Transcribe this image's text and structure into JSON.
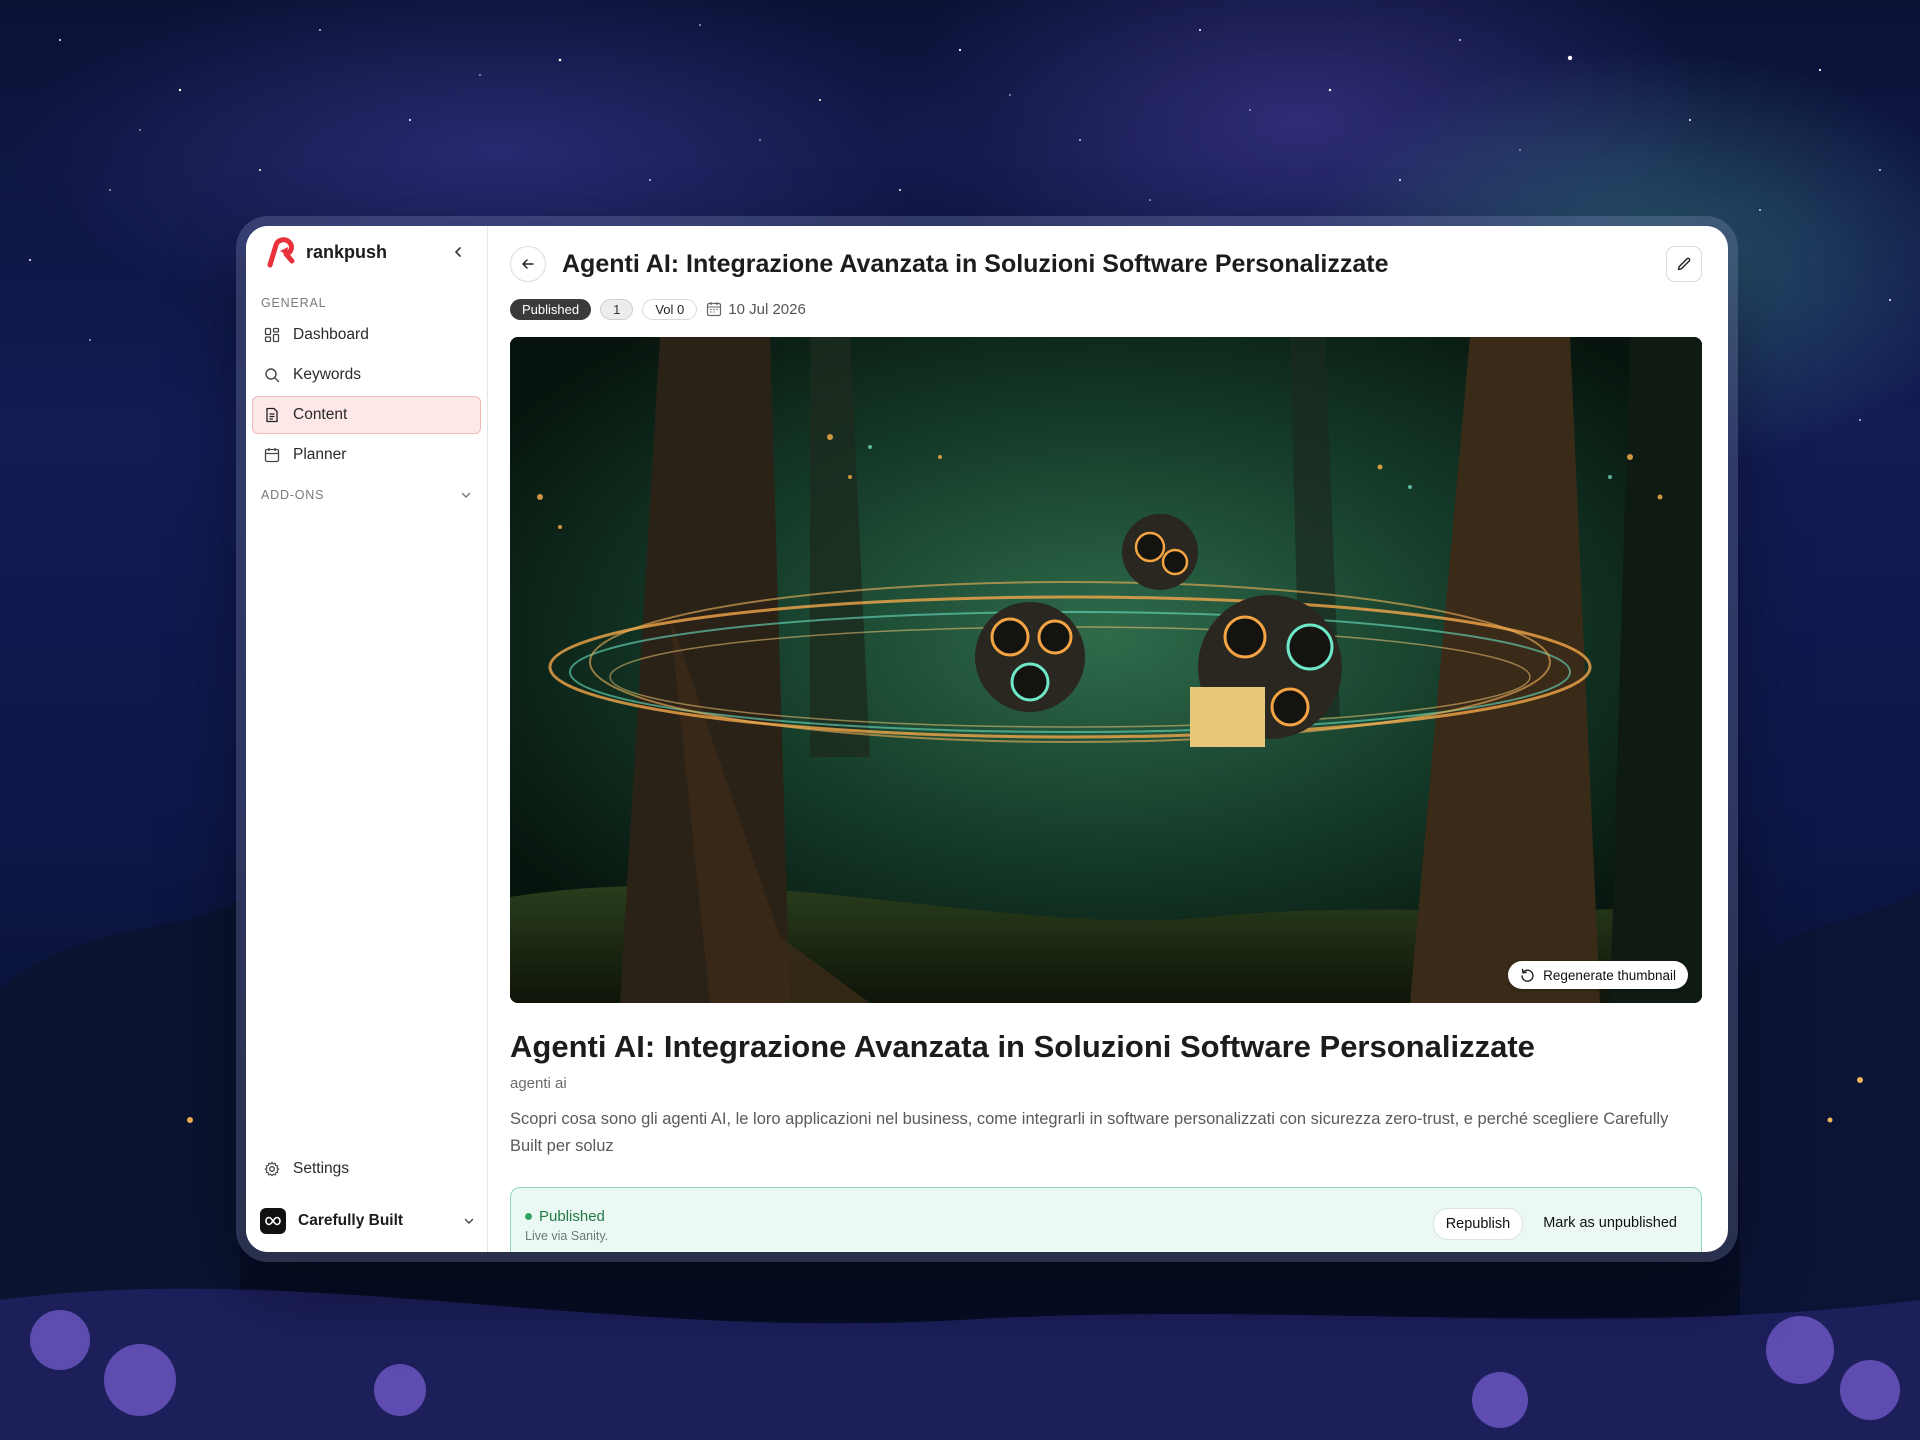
{
  "sidebar": {
    "brand_name": "rankpush",
    "general_label": "GENERAL",
    "items": [
      {
        "label": "Dashboard",
        "icon": "dashboard-icon"
      },
      {
        "label": "Keywords",
        "icon": "search-icon"
      },
      {
        "label": "Content",
        "icon": "document-icon",
        "active": true
      },
      {
        "label": "Planner",
        "icon": "calendar-icon"
      }
    ],
    "addons_label": "ADD-ONS",
    "settings_label": "Settings",
    "workspace_name": "Carefully Built"
  },
  "header": {
    "title": "Agenti AI: Integrazione Avanzata in Soluzioni Software Personalizzate",
    "status_badge": "Published",
    "count_badge": "1",
    "volume_badge": "Vol 0",
    "date": "10 Jul 2026"
  },
  "hero": {
    "regenerate_label": "Regenerate thumbnail"
  },
  "article": {
    "title": "Agenti AI: Integrazione Avanzata in Soluzioni Software Personalizzate",
    "keyword": "agenti ai",
    "description": "Scopri cosa sono gli agenti AI, le loro applicazioni nel business, come integrarli in software personalizzati con sicurezza zero-trust, e perché scegliere Carefully Built per soluz"
  },
  "status_card": {
    "label": "Published",
    "sub": "Live via Sanity.",
    "republish_label": "Republish",
    "unpublish_label": "Mark as unpublished"
  },
  "colors": {
    "brand": "#e8313a",
    "active_bg": "#fde7e7",
    "published_green": "#1f7a46",
    "card_bg": "#ecf8f3"
  }
}
